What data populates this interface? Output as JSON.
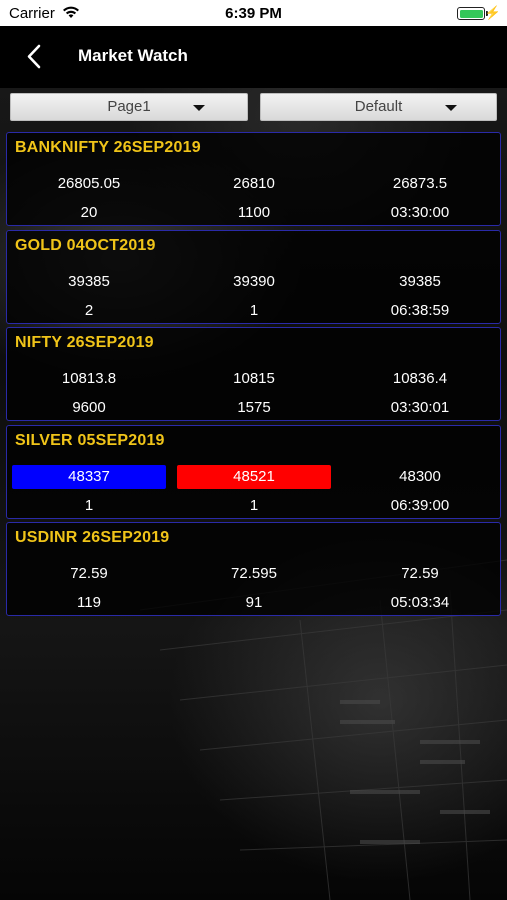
{
  "status_bar": {
    "carrier": "Carrier",
    "time": "6:39 PM"
  },
  "nav": {
    "title": "Market Watch"
  },
  "filters": {
    "page": "Page1",
    "view": "Default"
  },
  "quotes": [
    {
      "symbol": "BANKNIFTY 26SEP2019",
      "bid": "26805.05",
      "ask": "26810",
      "ltp": "26873.5",
      "bid_qty": "20",
      "ask_qty": "1100",
      "time": "03:30:00"
    },
    {
      "symbol": "GOLD 04OCT2019",
      "bid": "39385",
      "ask": "39390",
      "ltp": "39385",
      "bid_qty": "2",
      "ask_qty": "1",
      "time": "06:38:59"
    },
    {
      "symbol": "NIFTY 26SEP2019",
      "bid": "10813.8",
      "ask": "10815",
      "ltp": "10836.4",
      "bid_qty": "9600",
      "ask_qty": "1575",
      "time": "03:30:01"
    },
    {
      "symbol": "SILVER 05SEP2019",
      "bid": "48337",
      "ask": "48521",
      "ltp": "48300",
      "bid_qty": "1",
      "ask_qty": "1",
      "time": "06:39:00",
      "bid_highlight": "#0000ff",
      "ask_highlight": "#ff0000"
    },
    {
      "symbol": "USDINR 26SEP2019",
      "bid": "72.59",
      "ask": "72.595",
      "ltp": "72.59",
      "bid_qty": "119",
      "ask_qty": "91",
      "time": "05:03:34"
    }
  ],
  "colors": {
    "symbol_text": "#f0c419",
    "card_border": "#2a2aa8",
    "bid_up": "#0000ff",
    "ask_down": "#ff0000",
    "battery": "#34c759"
  }
}
